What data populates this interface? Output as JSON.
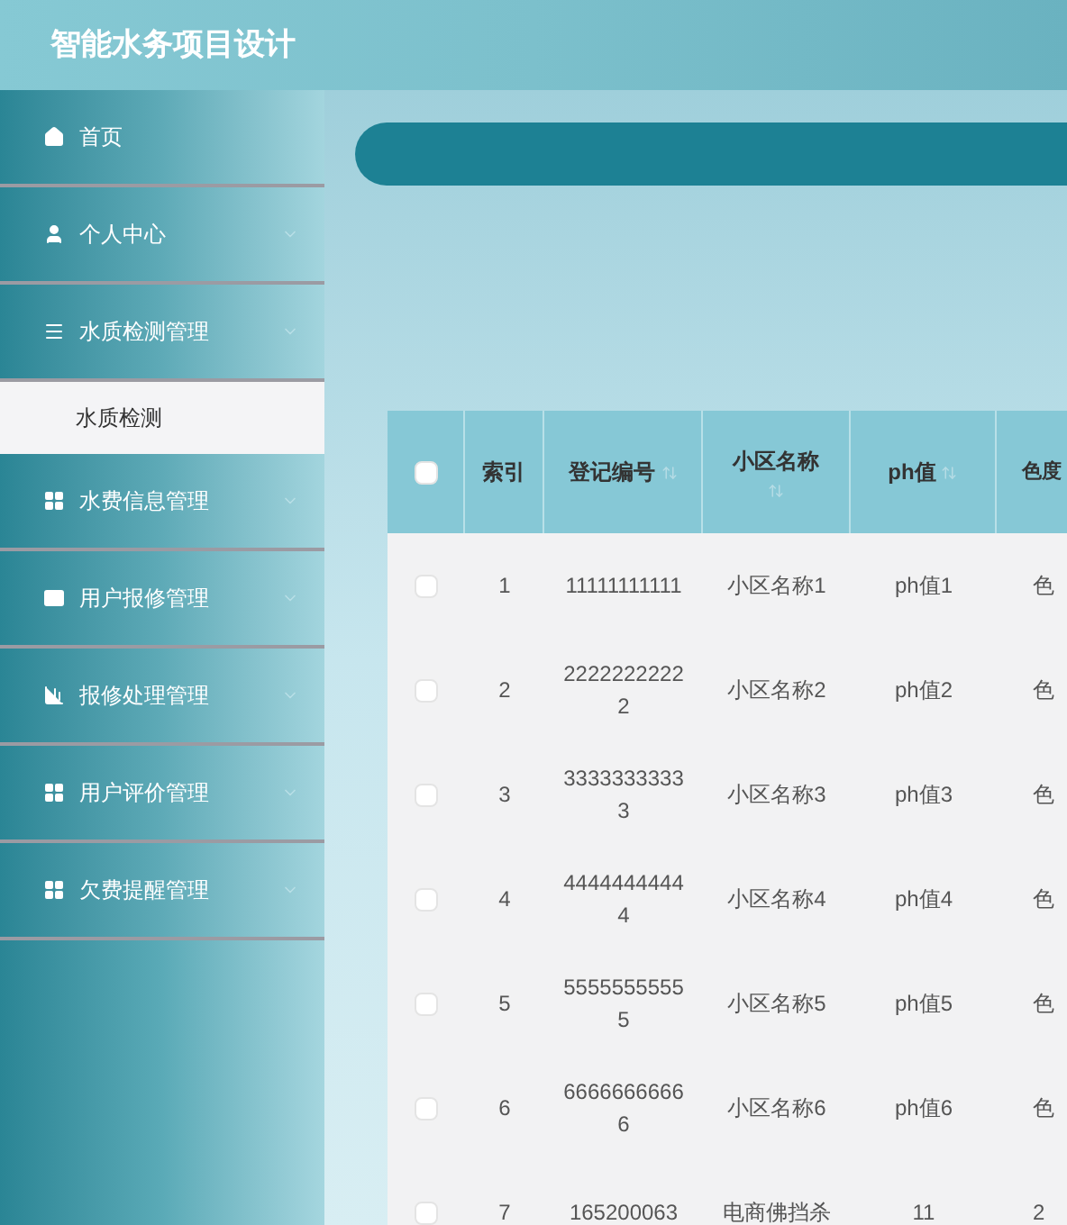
{
  "header": {
    "title": "智能水务项目设计"
  },
  "sidebar": {
    "items": [
      {
        "label": "首页",
        "expandable": false
      },
      {
        "label": "个人中心",
        "expandable": true
      },
      {
        "label": "水质检测管理",
        "expandable": true,
        "children": [
          {
            "label": "水质检测",
            "selected": true
          }
        ]
      },
      {
        "label": "水费信息管理",
        "expandable": true
      },
      {
        "label": "用户报修管理",
        "expandable": true
      },
      {
        "label": "报修处理管理",
        "expandable": true
      },
      {
        "label": "用户评价管理",
        "expandable": true
      },
      {
        "label": "欠费提醒管理",
        "expandable": true
      }
    ]
  },
  "table": {
    "select_all": {
      "checked": false
    },
    "columns": [
      {
        "label": "索引",
        "sortable": false
      },
      {
        "label": "登记编号",
        "sortable": true
      },
      {
        "label": "小区名称",
        "sortable": true
      },
      {
        "label": "ph值",
        "sortable": true
      },
      {
        "label": "色度"
      }
    ],
    "rows": [
      {
        "checked": false,
        "cells": [
          "1",
          "11111111111",
          "小区名称1",
          "ph值1",
          "色"
        ]
      },
      {
        "checked": false,
        "cells": [
          "2",
          "22222222222",
          "小区名称2",
          "ph值2",
          "色"
        ]
      },
      {
        "checked": false,
        "cells": [
          "3",
          "33333333333",
          "小区名称3",
          "ph值3",
          "色"
        ]
      },
      {
        "checked": false,
        "cells": [
          "4",
          "44444444444",
          "小区名称4",
          "ph值4",
          "色"
        ]
      },
      {
        "checked": false,
        "cells": [
          "5",
          "55555555555",
          "小区名称5",
          "ph值5",
          "色"
        ]
      },
      {
        "checked": false,
        "cells": [
          "6",
          "66666666666",
          "小区名称6",
          "ph值6",
          "色"
        ]
      },
      {
        "checked": false,
        "cells": [
          "7",
          "165200063",
          "电商佛挡杀",
          "11",
          "2"
        ]
      }
    ]
  }
}
